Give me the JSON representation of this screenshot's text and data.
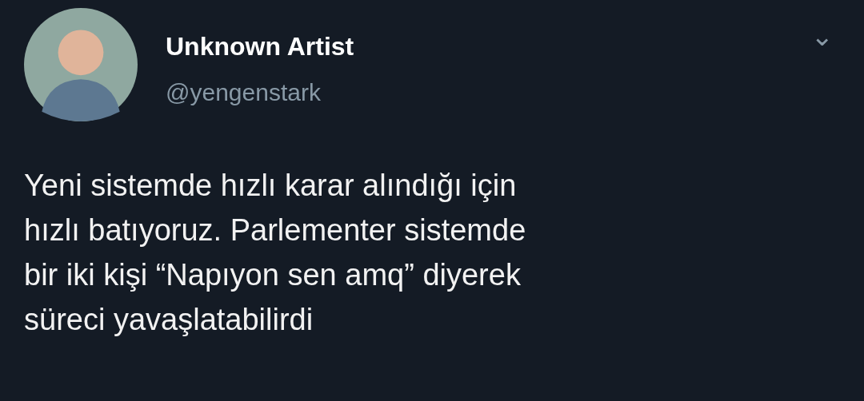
{
  "tweet": {
    "author": {
      "name": "Unknown Artist",
      "handle": "@yengenstark"
    },
    "menu_icon": "⌄",
    "text": "Yeni sistemde hızlı karar alındığı için\nhızlı batıyoruz. Parlementer sistemde\nbir iki kişi “Napıyon sen amq” diyerek\nsüreci yavaşlatabilirdi"
  }
}
